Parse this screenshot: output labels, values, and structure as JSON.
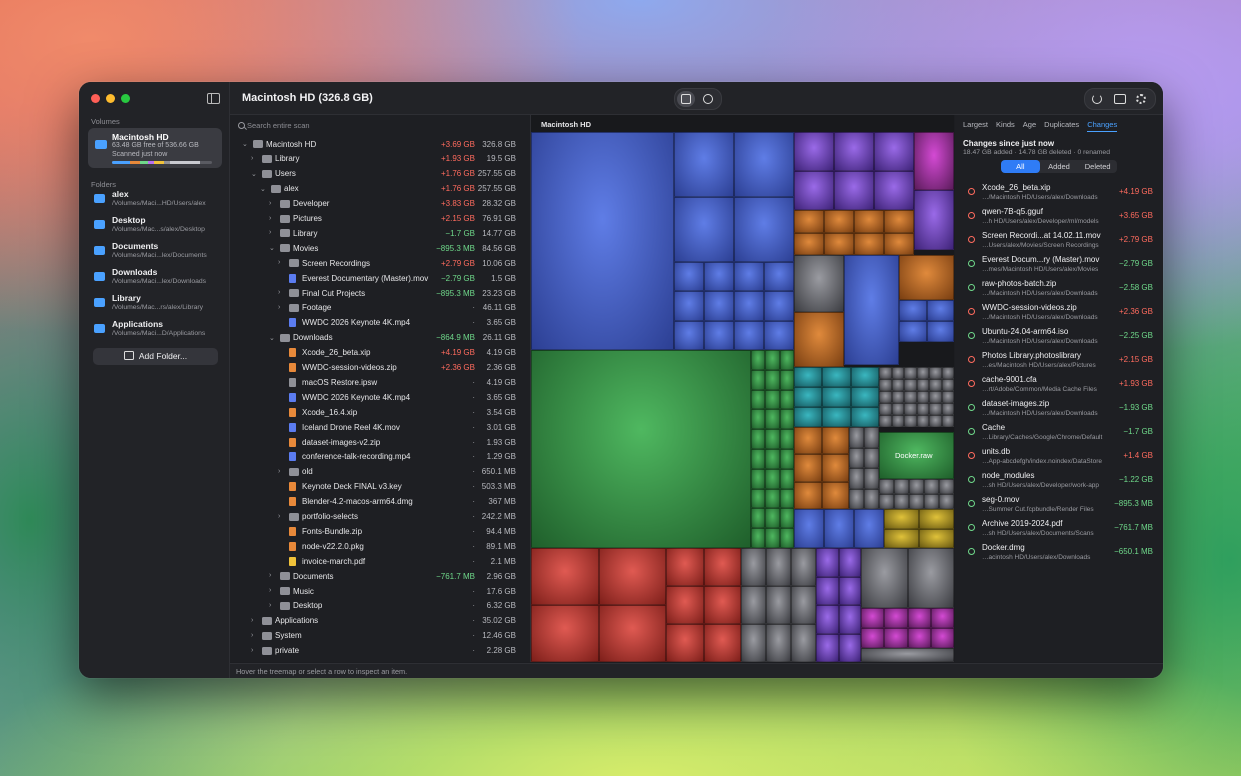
{
  "window": {
    "title": "Macintosh HD (326.8 GB)"
  },
  "sidebar": {
    "volumes_title": "Volumes",
    "volume": {
      "name": "Macintosh HD",
      "free": "63.48 GB free of 536.66 GB",
      "scanned": "Scanned just now"
    },
    "folders_title": "Folders",
    "folders": [
      {
        "name": "alex",
        "path": "/Volumes/Maci...HD/Users/alex",
        "icon": "folder-icon",
        "color": "#4aa1ff"
      },
      {
        "name": "Desktop",
        "path": "/Volumes/Mac...s/alex/Desktop",
        "icon": "desktop-icon",
        "color": "#4aa1ff"
      },
      {
        "name": "Documents",
        "path": "/Volumes/Maci...lex/Documents",
        "icon": "document-icon",
        "color": "#4aa1ff"
      },
      {
        "name": "Downloads",
        "path": "/Volumes/Maci...lex/Downloads",
        "icon": "download-icon",
        "color": "#4aa1ff"
      },
      {
        "name": "Library",
        "path": "/Volumes/Mac...rs/alex/Library",
        "icon": "library-icon",
        "color": "#4aa1ff"
      },
      {
        "name": "Applications",
        "path": "/Volumes/Maci...D/Applications",
        "icon": "apps-icon",
        "color": "#4aa1ff"
      }
    ],
    "add_folder": "Add Folder..."
  },
  "list": {
    "search_placeholder": "Search entire scan",
    "rows": [
      {
        "name": "Macintosh HD",
        "depth": 0,
        "chev": "⌄",
        "kind": "folder",
        "delta": "+3.69 GB",
        "dir": "up",
        "size": "326.8 GB"
      },
      {
        "name": "Library",
        "depth": 1,
        "chev": "›",
        "kind": "folder",
        "delta": "+1.93 GB",
        "dir": "up",
        "size": "19.5 GB"
      },
      {
        "name": "Users",
        "depth": 1,
        "chev": "⌄",
        "kind": "folder",
        "delta": "+1.76 GB",
        "dir": "up",
        "size": "257.55 GB"
      },
      {
        "name": "alex",
        "depth": 2,
        "chev": "⌄",
        "kind": "folder",
        "delta": "+1.76 GB",
        "dir": "up",
        "size": "257.55 GB"
      },
      {
        "name": "Developer",
        "depth": 3,
        "chev": "›",
        "kind": "folder",
        "delta": "+3.83 GB",
        "dir": "up",
        "size": "28.32 GB"
      },
      {
        "name": "Pictures",
        "depth": 3,
        "chev": "›",
        "kind": "folder",
        "delta": "+2.15 GB",
        "dir": "up",
        "size": "76.91 GB"
      },
      {
        "name": "Library",
        "depth": 3,
        "chev": "›",
        "kind": "folder",
        "delta": "−1.7 GB",
        "dir": "down",
        "size": "14.77 GB"
      },
      {
        "name": "Movies",
        "depth": 3,
        "chev": "⌄",
        "kind": "folder",
        "delta": "−895.3 MB",
        "dir": "down",
        "size": "84.56 GB"
      },
      {
        "name": "Screen Recordings",
        "depth": 4,
        "chev": "›",
        "kind": "folder",
        "delta": "+2.79 GB",
        "dir": "up",
        "size": "10.06 GB"
      },
      {
        "name": "Everest Documentary (Master).mov",
        "depth": 4,
        "chev": "",
        "kind": "file",
        "color": "#5b7cf0",
        "delta": "−2.79 GB",
        "dir": "down",
        "size": "1.5 GB"
      },
      {
        "name": "Final Cut Projects",
        "depth": 4,
        "chev": "›",
        "kind": "folder",
        "delta": "−895.3 MB",
        "dir": "down",
        "size": "23.23 GB"
      },
      {
        "name": "Footage",
        "depth": 4,
        "chev": "›",
        "kind": "folder",
        "delta": "·",
        "dir": "none",
        "size": "46.11 GB"
      },
      {
        "name": "WWDC 2026 Keynote 4K.mp4",
        "depth": 4,
        "chev": "",
        "kind": "file",
        "color": "#5b7cf0",
        "delta": "·",
        "dir": "none",
        "size": "3.65 GB"
      },
      {
        "name": "Downloads",
        "depth": 3,
        "chev": "⌄",
        "kind": "folder",
        "delta": "−864.9 MB",
        "dir": "down",
        "size": "26.11 GB"
      },
      {
        "name": "Xcode_26_beta.xip",
        "depth": 4,
        "chev": "",
        "kind": "file",
        "color": "#e8893a",
        "delta": "+4.19 GB",
        "dir": "up",
        "size": "4.19 GB"
      },
      {
        "name": "WWDC-session-videos.zip",
        "depth": 4,
        "chev": "",
        "kind": "file",
        "color": "#e8893a",
        "delta": "+2.36 GB",
        "dir": "up",
        "size": "2.36 GB"
      },
      {
        "name": "macOS Restore.ipsw",
        "depth": 4,
        "chev": "",
        "kind": "file",
        "color": "#8f9097",
        "delta": "·",
        "dir": "none",
        "size": "4.19 GB"
      },
      {
        "name": "WWDC 2026 Keynote 4K.mp4",
        "depth": 4,
        "chev": "",
        "kind": "file",
        "color": "#5b7cf0",
        "delta": "·",
        "dir": "none",
        "size": "3.65 GB"
      },
      {
        "name": "Xcode_16.4.xip",
        "depth": 4,
        "chev": "",
        "kind": "file",
        "color": "#e8893a",
        "delta": "·",
        "dir": "none",
        "size": "3.54 GB"
      },
      {
        "name": "Iceland Drone Reel 4K.mov",
        "depth": 4,
        "chev": "",
        "kind": "file",
        "color": "#5b7cf0",
        "delta": "·",
        "dir": "none",
        "size": "3.01 GB"
      },
      {
        "name": "dataset-images-v2.zip",
        "depth": 4,
        "chev": "",
        "kind": "file",
        "color": "#e8893a",
        "delta": "·",
        "dir": "none",
        "size": "1.93 GB"
      },
      {
        "name": "conference-talk-recording.mp4",
        "depth": 4,
        "chev": "",
        "kind": "file",
        "color": "#5b7cf0",
        "delta": "·",
        "dir": "none",
        "size": "1.29 GB"
      },
      {
        "name": "old",
        "depth": 4,
        "chev": "›",
        "kind": "folder",
        "delta": "·",
        "dir": "none",
        "size": "650.1 MB"
      },
      {
        "name": "Keynote Deck FINAL v3.key",
        "depth": 4,
        "chev": "",
        "kind": "file",
        "color": "#e8893a",
        "delta": "·",
        "dir": "none",
        "size": "503.3 MB"
      },
      {
        "name": "Blender-4.2-macos-arm64.dmg",
        "depth": 4,
        "chev": "",
        "kind": "file",
        "color": "#e8893a",
        "delta": "·",
        "dir": "none",
        "size": "367 MB"
      },
      {
        "name": "portfolio-selects",
        "depth": 4,
        "chev": "›",
        "kind": "folder",
        "delta": "·",
        "dir": "none",
        "size": "242.2 MB"
      },
      {
        "name": "Fonts-Bundle.zip",
        "depth": 4,
        "chev": "",
        "kind": "file",
        "color": "#e8893a",
        "delta": "·",
        "dir": "none",
        "size": "94.4 MB"
      },
      {
        "name": "node-v22.2.0.pkg",
        "depth": 4,
        "chev": "",
        "kind": "file",
        "color": "#e8893a",
        "delta": "·",
        "dir": "none",
        "size": "89.1 MB"
      },
      {
        "name": "invoice-march.pdf",
        "depth": 4,
        "chev": "",
        "kind": "file",
        "color": "#f0c23a",
        "delta": "·",
        "dir": "none",
        "size": "2.1 MB"
      },
      {
        "name": "Documents",
        "depth": 3,
        "chev": "›",
        "kind": "folder",
        "delta": "−761.7 MB",
        "dir": "down",
        "size": "2.96 GB"
      },
      {
        "name": "Music",
        "depth": 3,
        "chev": "›",
        "kind": "folder",
        "delta": "·",
        "dir": "none",
        "size": "17.6 GB"
      },
      {
        "name": "Desktop",
        "depth": 3,
        "chev": "›",
        "kind": "folder",
        "delta": "·",
        "dir": "none",
        "size": "6.32 GB"
      },
      {
        "name": "Applications",
        "depth": 1,
        "chev": "›",
        "kind": "folder",
        "delta": "·",
        "dir": "none",
        "size": "35.02 GB"
      },
      {
        "name": "System",
        "depth": 1,
        "chev": "›",
        "kind": "folder",
        "delta": "·",
        "dir": "none",
        "size": "12.46 GB"
      },
      {
        "name": "private",
        "depth": 1,
        "chev": "›",
        "kind": "folder",
        "delta": "·",
        "dir": "none",
        "size": "2.28 GB"
      }
    ]
  },
  "treemap": {
    "title": "Macintosh HD",
    "hover_label": "Docker.raw"
  },
  "changes": {
    "tabs": [
      "Largest",
      "Kinds",
      "Age",
      "Duplicates",
      "Changes"
    ],
    "active_tab": "Changes",
    "title": "Changes since just now",
    "summary": "18.47 GB added · 14.78 GB deleted · 0 renamed",
    "filters": [
      "All",
      "Added",
      "Deleted"
    ],
    "active_filter": "All",
    "items": [
      {
        "name": "Xcode_26_beta.xip",
        "path": "…/Macintosh HD/Users/alex/Downloads",
        "delta": "+4.19 GB",
        "dir": "up"
      },
      {
        "name": "qwen-7B-q5.gguf",
        "path": "…h HD/Users/alex/Developer/ml/models",
        "delta": "+3.65 GB",
        "dir": "up"
      },
      {
        "name": "Screen Recordi...at 14.02.11.mov",
        "path": "…Users/alex/Movies/Screen Recordings",
        "delta": "+2.79 GB",
        "dir": "up"
      },
      {
        "name": "Everest Docum...ry (Master).mov",
        "path": "…mes/Macintosh HD/Users/alex/Movies",
        "delta": "−2.79 GB",
        "dir": "down"
      },
      {
        "name": "raw-photos-batch.zip",
        "path": "…/Macintosh HD/Users/alex/Downloads",
        "delta": "−2.58 GB",
        "dir": "down"
      },
      {
        "name": "WWDC-session-videos.zip",
        "path": "…/Macintosh HD/Users/alex/Downloads",
        "delta": "+2.36 GB",
        "dir": "up"
      },
      {
        "name": "Ubuntu-24.04-arm64.iso",
        "path": "…/Macintosh HD/Users/alex/Downloads",
        "delta": "−2.25 GB",
        "dir": "down"
      },
      {
        "name": "Photos Library.photoslibrary",
        "path": "…es/Macintosh HD/Users/alex/Pictures",
        "delta": "+2.15 GB",
        "dir": "up"
      },
      {
        "name": "cache-9001.cfa",
        "path": "…rt/Adobe/Common/Media Cache Files",
        "delta": "+1.93 GB",
        "dir": "up"
      },
      {
        "name": "dataset-images.zip",
        "path": "…/Macintosh HD/Users/alex/Downloads",
        "delta": "−1.93 GB",
        "dir": "down"
      },
      {
        "name": "Cache",
        "path": "…Library/Caches/Google/Chrome/Default",
        "delta": "−1.7 GB",
        "dir": "down"
      },
      {
        "name": "units.db",
        "path": "…App-abcdefgh/index.noindex/DataStore",
        "delta": "+1.4 GB",
        "dir": "up"
      },
      {
        "name": "node_modules",
        "path": "…sh HD/Users/alex/Developer/work-app",
        "delta": "−1.22 GB",
        "dir": "down"
      },
      {
        "name": "seg-0.mov",
        "path": "…Summer Cut.fcpbundle/Render Files",
        "delta": "−895.3 MB",
        "dir": "down"
      },
      {
        "name": "Archive 2019-2024.pdf",
        "path": "…sh HD/Users/alex/Documents/Scans",
        "delta": "−761.7 MB",
        "dir": "down"
      },
      {
        "name": "Docker.dmg",
        "path": "…acintosh HD/Users/alex/Downloads",
        "delta": "−650.1 MB",
        "dir": "down"
      }
    ]
  },
  "status": "Hover the treemap or select a row to inspect an item.",
  "colors": {
    "accent": "#2f7cf6",
    "added": "#ff6b5e",
    "deleted": "#6fd88a"
  }
}
